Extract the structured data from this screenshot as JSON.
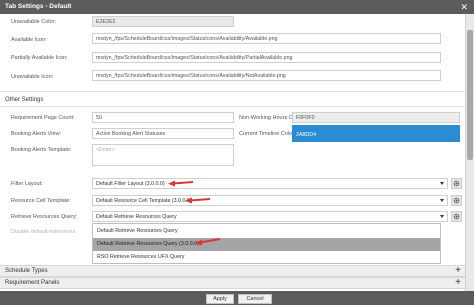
{
  "window": {
    "title": "Tab Settings - Default"
  },
  "availability": {
    "unavailable_color": {
      "label": "Unavailable Color:",
      "value": "E2E2E2"
    },
    "available_icon": {
      "label": "Available Icon:",
      "value": "msdyn_/fps/ScheduleBoard/css/images/StatusIcons/Availability/Available.png"
    },
    "partially_available_icon": {
      "label": "Partially Available Icon:",
      "value": "msdyn_/fps/ScheduleBoard/css/images/StatusIcons/Availability/PartialAvailable.png"
    },
    "unavailable_icon": {
      "label": "Unavailable Icon:",
      "value": "msdyn_/fps/ScheduleBoard/css/images/StatusIcons/Availability/NotAvailable.png"
    }
  },
  "other_settings": {
    "title": "Other Settings",
    "requirement_page_count": {
      "label": "Requirement Page Count:",
      "value": "50"
    },
    "non_working_hours_color": {
      "label": "Non-Working Hours Color:",
      "value": "F0F0F0"
    },
    "booking_alerts_view": {
      "label": "Booking Alerts View:",
      "value": "Active Booking Alert Statuses"
    },
    "current_timeline_color": {
      "label": "Current Timeline Color:",
      "value": "2A8DD4"
    },
    "booking_alerts_template": {
      "label": "Booking Alerts Template:",
      "placeholder": "<Enter>"
    },
    "filter_layout": {
      "label": "Filter Layout:",
      "value": "Default Filter Layout (3.0.0.0)"
    },
    "resource_cell_template": {
      "label": "Resource Cell Template:",
      "value": "Default Resource Cell Template (3.0.0.0)"
    },
    "retrieve_resources_query": {
      "label": "Retrieve Resources Query:",
      "value": "Default Retrieve Resources Query",
      "options": [
        "Default Retrieve Resources Query",
        "Default Retrieve Resources Query (3.0.0.0)",
        "RSO Retrieve Resources UFX Query"
      ],
      "highlighted_index": 1
    },
    "disable_label": "Disable default extensions"
  },
  "panels": [
    {
      "title": "Schedule Types"
    },
    {
      "title": "Requirement Panels"
    }
  ],
  "footer": {
    "apply": "Apply",
    "cancel": "Cancel"
  },
  "colors": {
    "titlebar": "#5c5c5c",
    "current_timeline": "#2A8DD4",
    "arrow": "#d9383a",
    "highlight": "#a5a5a5"
  }
}
